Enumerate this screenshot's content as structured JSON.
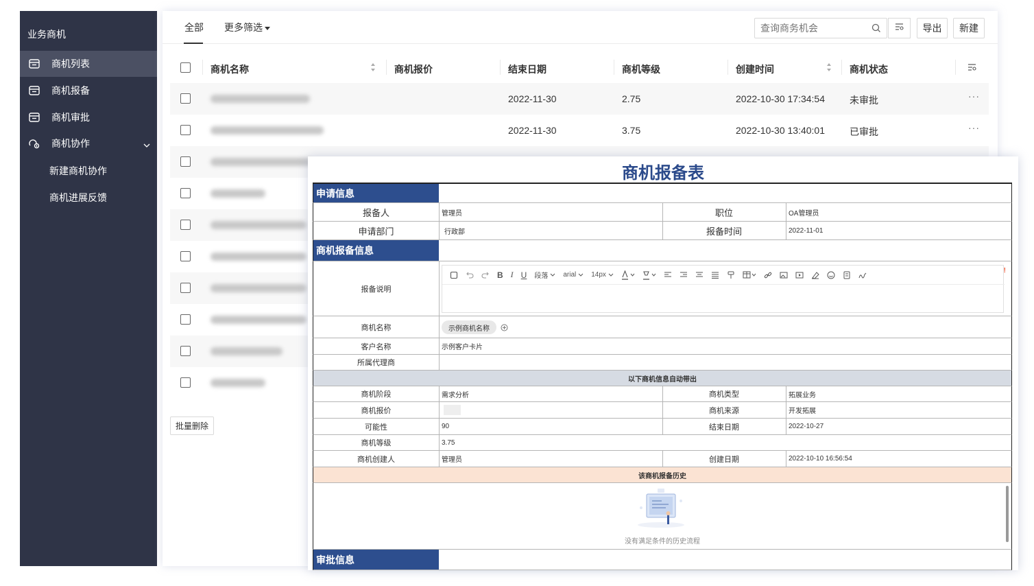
{
  "sidebar": {
    "title": "业务商机",
    "items": [
      {
        "label": "商机列表",
        "active": true
      },
      {
        "label": "商机报备"
      },
      {
        "label": "商机审批"
      },
      {
        "label": "商机协作"
      }
    ],
    "subitems": [
      "新建商机协作",
      "商机进展反馈"
    ]
  },
  "toolbar": {
    "tab_all": "全部",
    "tab_more": "更多筛选",
    "search_placeholder": "查询商务机会",
    "export_label": "导出",
    "new_label": "新建"
  },
  "table": {
    "columns": [
      "商机名称",
      "商机报价",
      "结束日期",
      "商机等级",
      "创建时间",
      "商机状态"
    ],
    "rows": [
      {
        "end_date": "2022-11-30",
        "level": "2.75",
        "created": "2022-10-30 17:34:54",
        "status": "未审批"
      },
      {
        "end_date": "2022-11-30",
        "level": "3.75",
        "created": "2022-10-30 13:40:01",
        "status": "已审批"
      }
    ],
    "row_more": "···",
    "batch_delete": "批量删除"
  },
  "form": {
    "title": "商机报备表",
    "section_apply": "申请信息",
    "reporter_label": "报备人",
    "reporter_value": "管理员",
    "position_label": "职位",
    "position_value": "OA管理员",
    "dept_label": "申请部门",
    "dept_value": "行政部",
    "report_time_label": "报备时间",
    "report_time_value": "2022-11-01",
    "section_report": "商机报备信息",
    "desc_label": "报备说明",
    "editor": {
      "para": "段落",
      "font": "arial",
      "size": "14px"
    },
    "opp_name_label": "商机名称",
    "opp_name_value": "示例商机名称",
    "customer_label": "客户名称",
    "customer_value": "示例客户卡片",
    "agent_label": "所属代理商",
    "auto_band": "以下商机信息自动带出",
    "stage_label": "商机阶段",
    "stage_value": "需求分析",
    "type_label": "商机类型",
    "type_value": "拓展业务",
    "price_label": "商机报价",
    "source_label": "商机来源",
    "source_value": "开发拓展",
    "possibility_label": "可能性",
    "possibility_value": "90",
    "end_label": "结束日期",
    "end_value": "2022-10-27",
    "grade_label": "商机等级",
    "grade_value": "3.75",
    "creator_label": "商机创建人",
    "creator_value": "管理员",
    "create_date_label": "创建日期",
    "create_date_value": "2022-10-10 16:56:54",
    "history_band": "该商机报备历史",
    "empty_text": "没有满足条件的历史流程",
    "section_approve": "审批信息"
  },
  "colors": {
    "sidebar_bg": "#2f3447",
    "section_blue": "#2d4e8e",
    "title_blue": "#2b4a8b",
    "band_gray": "#d6dbe3",
    "band_peach": "#fbe3d3"
  }
}
